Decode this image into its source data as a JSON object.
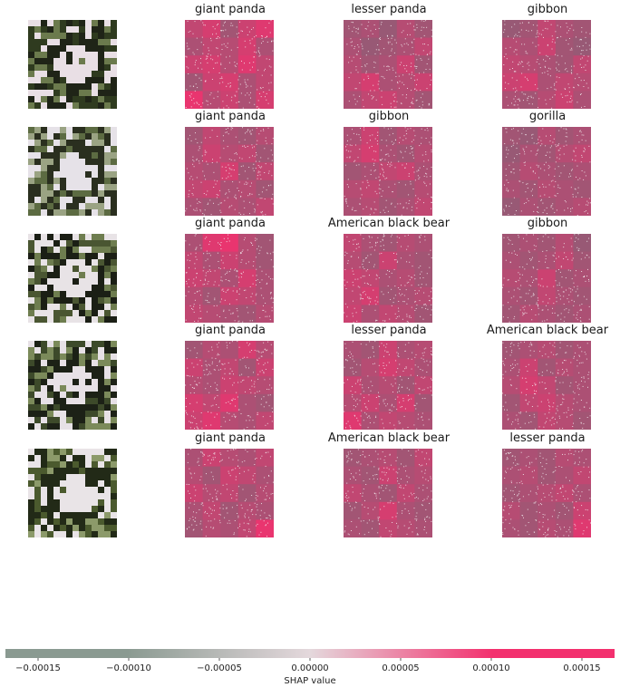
{
  "colors": {
    "negative": "#8a9a91",
    "neutral": "#e4d8dc",
    "positive": "#f3306e",
    "map_base": "#8e5e76"
  },
  "chart_data": {
    "type": "heatmap",
    "title": "",
    "rows": [
      {
        "image": "giant-panda-photo-1",
        "photo_palette": [
          "#2f3b1f",
          "#e9dfe5",
          "#6b7a4d",
          "#1f2417"
        ],
        "labels": [
          "giant panda",
          "lesser panda",
          "gibbon"
        ],
        "intensity": [
          [
            0.5,
            0.7,
            0.2,
            0.6,
            0.8,
            0.3,
            0.5,
            0.4,
            0.7,
            0.3,
            0.6,
            0.7,
            0.4,
            0.8,
            0.5,
            0.2,
            0.6,
            0.7,
            0.3,
            0.5,
            0.9,
            0.4,
            0.6,
            0.3,
            0.7
          ],
          [
            0.2,
            0.3,
            0.1,
            0.4,
            0.2,
            0.3,
            0.1,
            0.2,
            0.3,
            0.5,
            0.4,
            0.2,
            0.3,
            0.6,
            0.2,
            0.5,
            0.7,
            0.3,
            0.4,
            0.6,
            0.3,
            0.5,
            0.6,
            0.4,
            0.2
          ],
          [
            0.1,
            0.2,
            0.5,
            0.3,
            0.2,
            0.4,
            0.3,
            0.6,
            0.2,
            0.1,
            0.5,
            0.4,
            0.3,
            0.2,
            0.5,
            0.6,
            0.7,
            0.3,
            0.5,
            0.4,
            0.3,
            0.2,
            0.4,
            0.6,
            0.3
          ]
        ]
      },
      {
        "image": "giant-panda-photo-2",
        "photo_palette": [
          "#e6e2e8",
          "#5c6b42",
          "#2a2f1f",
          "#9aa383"
        ],
        "labels": [
          "giant panda",
          "gibbon",
          "gorilla"
        ],
        "intensity": [
          [
            0.2,
            0.5,
            0.3,
            0.2,
            0.4,
            0.3,
            0.6,
            0.4,
            0.5,
            0.2,
            0.4,
            0.3,
            0.7,
            0.2,
            0.5,
            0.5,
            0.6,
            0.3,
            0.4,
            0.2,
            0.3,
            0.2,
            0.4,
            0.3,
            0.5
          ],
          [
            0.3,
            0.6,
            0.2,
            0.4,
            0.3,
            0.5,
            0.7,
            0.3,
            0.2,
            0.4,
            0.2,
            0.3,
            0.5,
            0.6,
            0.3,
            0.4,
            0.5,
            0.3,
            0.2,
            0.4,
            0.3,
            0.4,
            0.2,
            0.3,
            0.5
          ],
          [
            0.2,
            0.1,
            0.4,
            0.2,
            0.3,
            0.1,
            0.3,
            0.2,
            0.4,
            0.5,
            0.2,
            0.4,
            0.3,
            0.2,
            0.3,
            0.3,
            0.2,
            0.4,
            0.3,
            0.2,
            0.1,
            0.3,
            0.2,
            0.3,
            0.4
          ]
        ]
      },
      {
        "image": "giant-panda-photo-3",
        "photo_palette": [
          "#6e7d4f",
          "#e8e3e6",
          "#1b1f15",
          "#4a5632"
        ],
        "labels": [
          "giant panda",
          "American black bear",
          "gibbon"
        ],
        "intensity": [
          [
            0.3,
            0.8,
            0.9,
            0.4,
            0.2,
            0.5,
            0.3,
            0.6,
            0.4,
            0.2,
            0.6,
            0.5,
            0.3,
            0.7,
            0.3,
            0.4,
            0.2,
            0.6,
            0.5,
            0.3,
            0.5,
            0.4,
            0.3,
            0.2,
            0.4
          ],
          [
            0.5,
            0.3,
            0.2,
            0.4,
            0.3,
            0.4,
            0.2,
            0.6,
            0.3,
            0.2,
            0.6,
            0.5,
            0.3,
            0.4,
            0.2,
            0.5,
            0.7,
            0.2,
            0.3,
            0.4,
            0.6,
            0.3,
            0.5,
            0.4,
            0.2
          ],
          [
            0.2,
            0.3,
            0.2,
            0.4,
            0.1,
            0.3,
            0.2,
            0.3,
            0.5,
            0.2,
            0.4,
            0.3,
            0.6,
            0.2,
            0.3,
            0.3,
            0.2,
            0.5,
            0.3,
            0.2,
            0.2,
            0.4,
            0.3,
            0.2,
            0.3
          ]
        ]
      },
      {
        "image": "giant-panda-photo-4",
        "photo_palette": [
          "#1c2116",
          "#e7e1e6",
          "#7b8a5a",
          "#3d4a2a"
        ],
        "labels": [
          "giant panda",
          "lesser panda",
          "American black bear"
        ],
        "intensity": [
          [
            0.2,
            0.4,
            0.3,
            0.7,
            0.4,
            0.6,
            0.3,
            0.5,
            0.2,
            0.6,
            0.4,
            0.3,
            0.6,
            0.5,
            0.4,
            0.7,
            0.5,
            0.8,
            0.3,
            0.2,
            0.6,
            0.8,
            0.4,
            0.3,
            0.5
          ],
          [
            0.3,
            0.2,
            0.6,
            0.3,
            0.4,
            0.2,
            0.4,
            0.7,
            0.5,
            0.3,
            0.6,
            0.3,
            0.4,
            0.2,
            0.5,
            0.4,
            0.6,
            0.3,
            0.7,
            0.2,
            0.8,
            0.3,
            0.5,
            0.4,
            0.3
          ],
          [
            0.2,
            0.3,
            0.4,
            0.2,
            0.3,
            0.3,
            0.6,
            0.2,
            0.4,
            0.3,
            0.4,
            0.7,
            0.5,
            0.2,
            0.3,
            0.2,
            0.5,
            0.6,
            0.4,
            0.3,
            0.3,
            0.2,
            0.5,
            0.4,
            0.2
          ]
        ]
      },
      {
        "image": "giant-panda-photo-5",
        "photo_palette": [
          "#4b5a2e",
          "#e9e4e7",
          "#222a17",
          "#8c9a6a"
        ],
        "labels": [
          "giant panda",
          "American black bear",
          "lesser panda"
        ],
        "intensity": [
          [
            0.3,
            0.6,
            0.4,
            0.3,
            0.5,
            0.4,
            0.2,
            0.6,
            0.5,
            0.3,
            0.6,
            0.4,
            0.5,
            0.2,
            0.4,
            0.3,
            0.5,
            0.2,
            0.4,
            0.3,
            0.2,
            0.4,
            0.3,
            0.5,
            0.9
          ],
          [
            0.2,
            0.3,
            0.4,
            0.2,
            0.5,
            0.3,
            0.2,
            0.6,
            0.3,
            0.4,
            0.5,
            0.3,
            0.2,
            0.5,
            0.3,
            0.2,
            0.4,
            0.7,
            0.3,
            0.2,
            0.3,
            0.2,
            0.5,
            0.4,
            0.3
          ],
          [
            0.2,
            0.3,
            0.2,
            0.4,
            0.3,
            0.3,
            0.4,
            0.2,
            0.3,
            0.5,
            0.2,
            0.3,
            0.4,
            0.5,
            0.3,
            0.4,
            0.2,
            0.3,
            0.2,
            0.6,
            0.3,
            0.2,
            0.4,
            0.3,
            0.8
          ]
        ]
      }
    ],
    "colorbar": {
      "label": "SHAP value",
      "range": [
        -0.000168,
        0.000168
      ],
      "ticks": [
        -0.00015,
        -0.0001,
        -5e-05,
        0.0,
        5e-05,
        0.0001,
        0.00015
      ],
      "tick_labels": [
        "−0.00015",
        "−0.00010",
        "−0.00005",
        "0.00000",
        "0.00005",
        "0.00010",
        "0.00015"
      ]
    }
  }
}
